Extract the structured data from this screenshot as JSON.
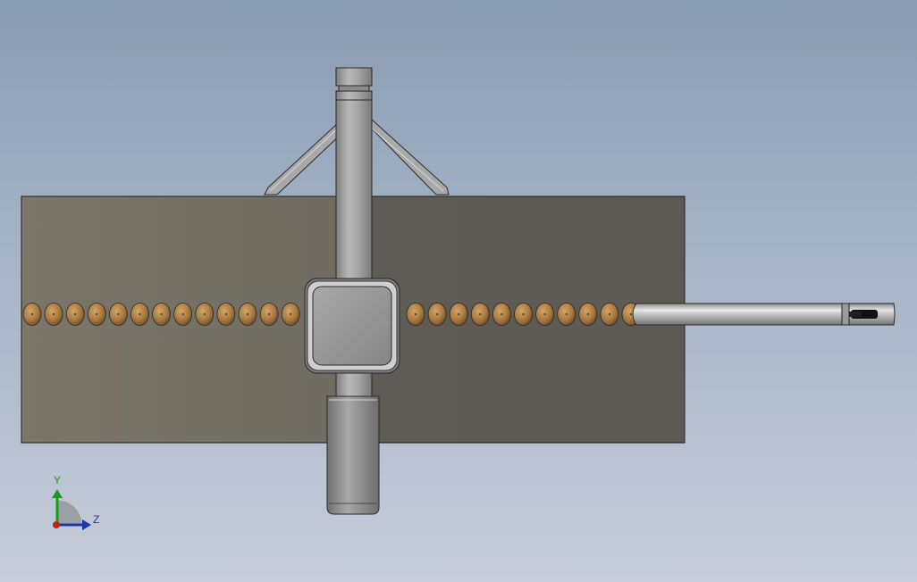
{
  "viewport": {
    "view": "model-view",
    "colors": {
      "background_top": "#8a9cb2",
      "background_bottom": "#c6cdd9",
      "plate_left": "#7b7668",
      "plate_right": "#5d5a53",
      "rod": "#b8b8b8",
      "knob": "#b0814a",
      "outline": "#2a2a2a"
    }
  },
  "model": {
    "knob_count_left": 13,
    "knob_count_right": 11
  },
  "triad": {
    "y_label": "Y",
    "z_label": "Z",
    "colors": {
      "y": "#1a9a1a",
      "z": "#1a3aa8",
      "x": "#c0201a"
    }
  }
}
